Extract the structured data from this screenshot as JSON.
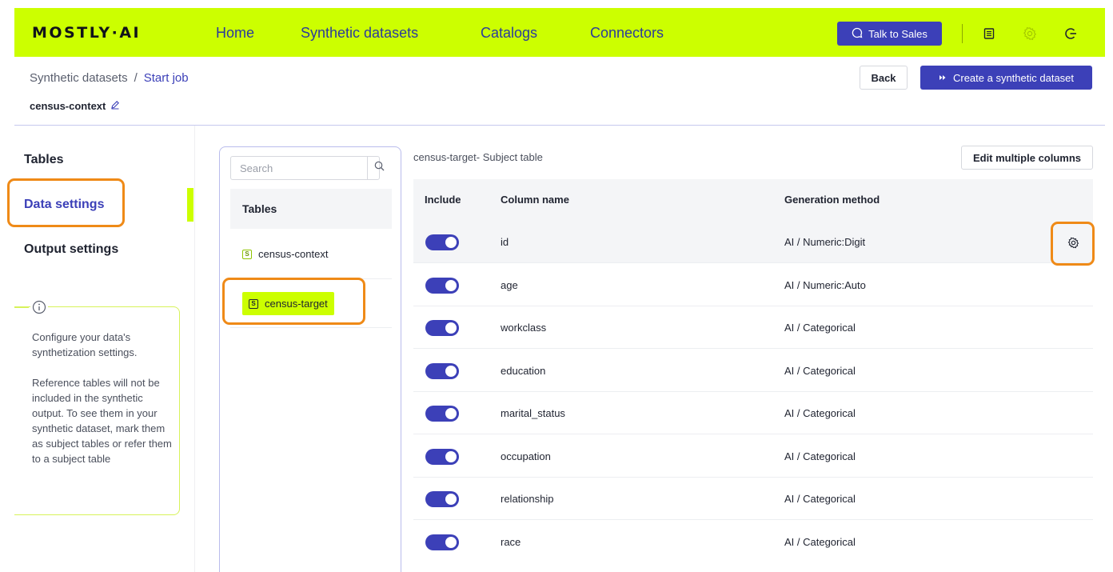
{
  "nav": {
    "logo": "MOSTLY·AI",
    "links": [
      "Home",
      "Synthetic datasets",
      "Catalogs",
      "Connectors"
    ],
    "talk_label": "Talk to Sales",
    "icons": [
      "document-icon",
      "gear-icon",
      "logout-icon"
    ],
    "accent_color": "#ccff00",
    "primary_color": "#3c40b8"
  },
  "header": {
    "breadcrumb_parent": "Synthetic datasets",
    "breadcrumb_separator": "/",
    "breadcrumb_current": "Start job",
    "dataset_name": "census-context",
    "back_label": "Back",
    "create_label": "Create a synthetic dataset"
  },
  "sidebar": {
    "items": [
      "Tables",
      "Data settings",
      "Output settings"
    ],
    "active": "Data settings",
    "info_paragraph_1": "Configure your data's synthetization settings.",
    "info_paragraph_2": "Reference tables will not be included in the synthetic output. To see them in your synthetic dataset, mark them as subject tables or refer them to a subject table"
  },
  "tables_panel": {
    "search_placeholder": "Search",
    "header": "Tables",
    "tables": [
      {
        "name": "census-context",
        "selected": false,
        "icon_letter": "S"
      },
      {
        "name": "census-target",
        "selected": true,
        "icon_letter": "S"
      }
    ]
  },
  "columns": {
    "subject_label": "census-target- Subject table",
    "edit_multi_label": "Edit multiple columns",
    "headers": {
      "include": "Include",
      "name": "Column name",
      "method": "Generation method"
    },
    "rows": [
      {
        "name": "id",
        "method": "AI / Numeric:Digit",
        "include": true
      },
      {
        "name": "age",
        "method": "AI / Numeric:Auto",
        "include": true
      },
      {
        "name": "workclass",
        "method": "AI / Categorical",
        "include": true
      },
      {
        "name": "education",
        "method": "AI / Categorical",
        "include": true
      },
      {
        "name": "marital_status",
        "method": "AI / Categorical",
        "include": true
      },
      {
        "name": "occupation",
        "method": "AI / Categorical",
        "include": true
      },
      {
        "name": "relationship",
        "method": "AI / Categorical",
        "include": true
      },
      {
        "name": "race",
        "method": "AI / Categorical",
        "include": true
      }
    ]
  },
  "highlight_color": "#ef8a17"
}
